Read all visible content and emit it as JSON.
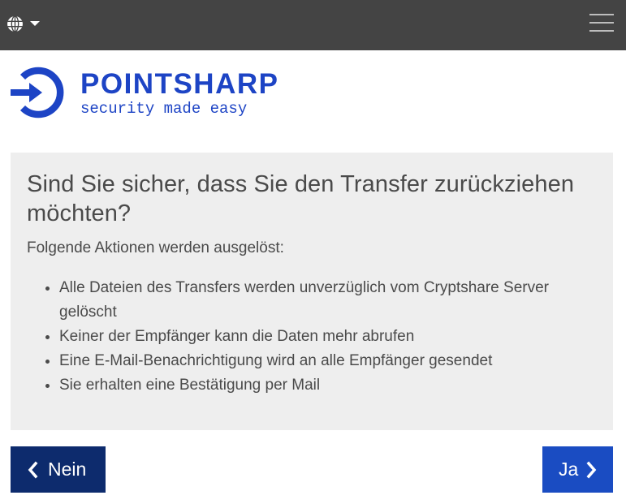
{
  "navbar": {
    "language_icon": "globe-icon",
    "dropdown_icon": "caret-down-icon",
    "menu_icon": "hamburger-menu-icon"
  },
  "logo": {
    "brand": "POINTSHARP",
    "tagline": "security made easy",
    "color": "#1d44c5"
  },
  "dialog": {
    "title": "Sind Sie sicher, dass Sie den Transfer zurückziehen möchten?",
    "lead": "Folgende Aktionen werden ausgelöst:",
    "items": [
      "Alle Dateien des Transfers werden unverzüglich vom Cryptshare Server gelöscht",
      "Keiner der Empfänger kann die Daten mehr abrufen",
      "Eine E-Mail-Benachrichtigung wird an alle Empfänger gesendet",
      "Sie erhalten eine Bestätigung per Mail"
    ]
  },
  "buttons": {
    "no_label": "Nein",
    "yes_label": "Ja",
    "no_color": "#0d2b6d",
    "yes_color": "#1a4cc2"
  }
}
